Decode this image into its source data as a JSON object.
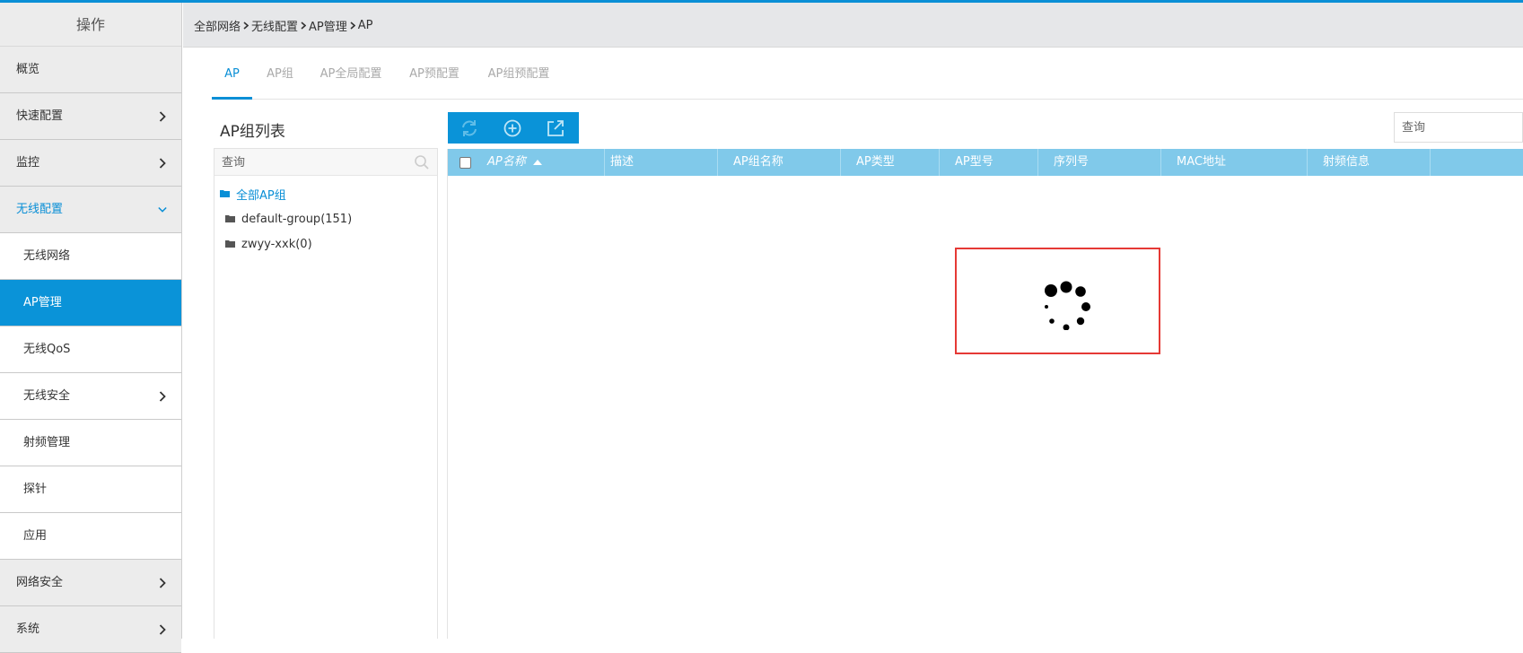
{
  "sidebar": {
    "title": "操作",
    "items": [
      {
        "label": "概览",
        "chevron": "none"
      },
      {
        "label": "快速配置",
        "chevron": "right"
      },
      {
        "label": "监控",
        "chevron": "right"
      },
      {
        "label": "无线配置",
        "chevron": "down",
        "state": "expanded"
      },
      {
        "label": "无线网络",
        "chevron": "none",
        "sub": true
      },
      {
        "label": "AP管理",
        "chevron": "none",
        "sub": true,
        "state": "active"
      },
      {
        "label": "无线QoS",
        "chevron": "none",
        "sub": true
      },
      {
        "label": "无线安全",
        "chevron": "right",
        "sub": true
      },
      {
        "label": "射频管理",
        "chevron": "none",
        "sub": true
      },
      {
        "label": "探针",
        "chevron": "none",
        "sub": true
      },
      {
        "label": "应用",
        "chevron": "none",
        "sub": true
      },
      {
        "label": "网络安全",
        "chevron": "right"
      },
      {
        "label": "系统",
        "chevron": "right"
      }
    ]
  },
  "breadcrumb": [
    "全部网络",
    "无线配置",
    "AP管理",
    "AP"
  ],
  "tabs": [
    {
      "label": "AP",
      "active": true
    },
    {
      "label": "AP组"
    },
    {
      "label": "AP全局配置"
    },
    {
      "label": "AP预配置"
    },
    {
      "label": "AP组预配置"
    }
  ],
  "left_panel": {
    "title": "AP组列表",
    "search_placeholder": "查询",
    "tree": [
      {
        "label": "全部AP组",
        "root": true
      },
      {
        "label": "default-group(151)"
      },
      {
        "label": "zwyy-xxk(0)"
      }
    ]
  },
  "toolbar": {
    "buttons": [
      {
        "name": "refresh-icon"
      },
      {
        "name": "add-circle-icon"
      },
      {
        "name": "export-icon"
      }
    ]
  },
  "table": {
    "search_placeholder": "查询",
    "columns": [
      "AP名称",
      "描述",
      "AP组名称",
      "AP类型",
      "AP型号",
      "序列号",
      "MAC地址",
      "射频信息"
    ],
    "sorted_column": "AP名称",
    "rows": []
  },
  "colors": {
    "accent": "#0a93d8",
    "table_header": "#80c9ea",
    "highlight_border": "#e53935"
  }
}
